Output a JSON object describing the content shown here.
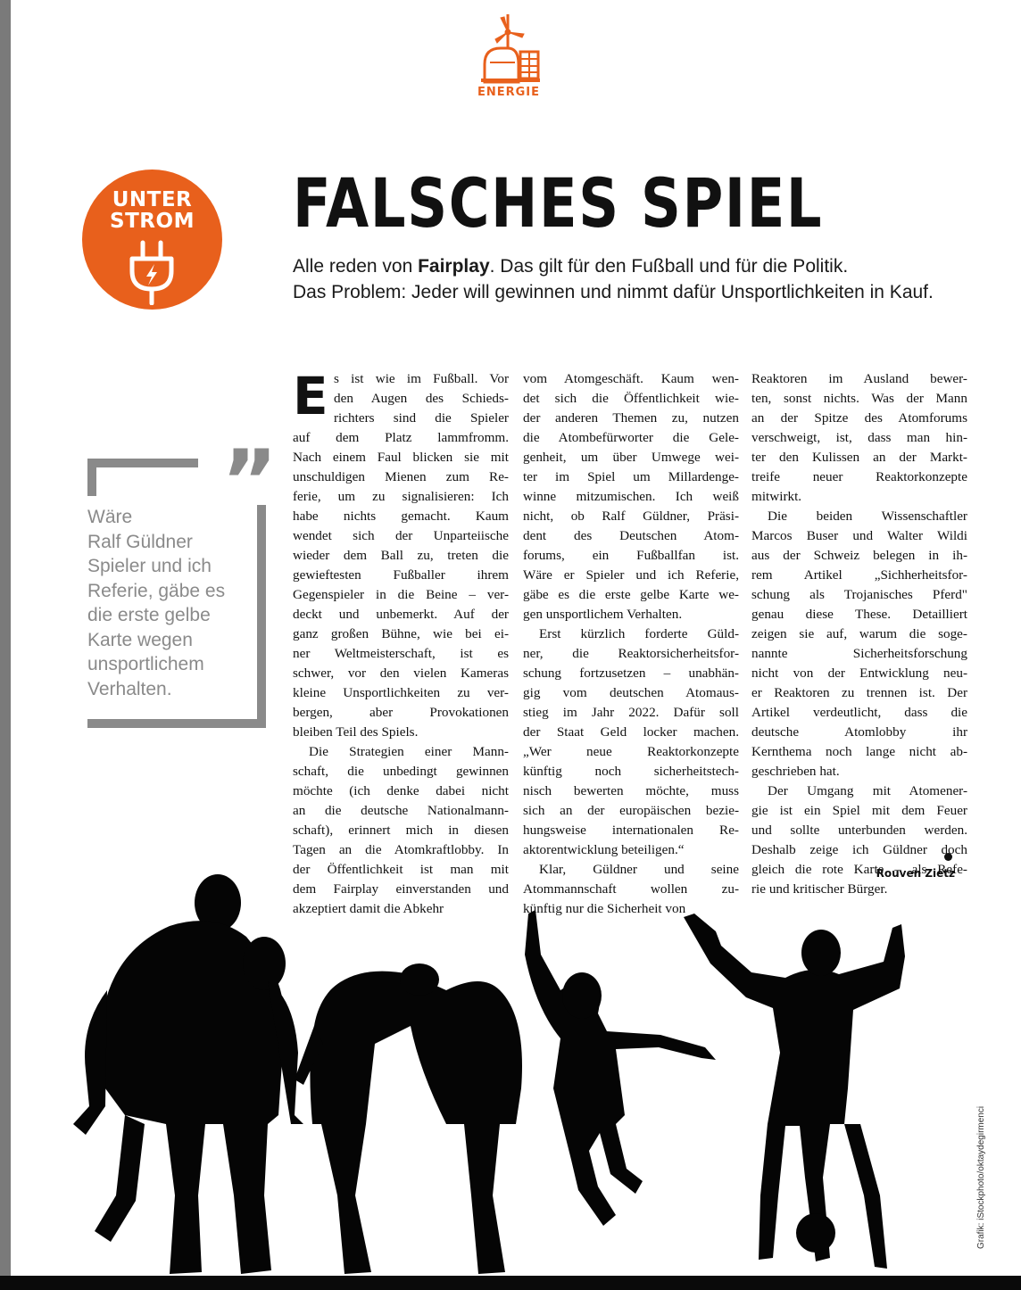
{
  "section": {
    "label": "ENERGIE",
    "icon": "power-plant-icon",
    "color": "#e8601c"
  },
  "badge": {
    "line1": "UNTER",
    "line2": "STROM",
    "icon": "plug-icon",
    "color": "#e8601c"
  },
  "headline": "FALSCHES SPIEL",
  "lead": {
    "line1_pre": "Alle reden von ",
    "line1_bold": "Fairplay",
    "line1_post": ". Das gilt für den Fußball und für die Politik.",
    "line2": "Das Problem: Jeder will gewinnen und nimmt dafür Unsportlichkeiten in Kauf."
  },
  "quote": {
    "marks": "”",
    "lines": [
      "Wäre",
      "Ralf Güldner",
      "Spieler und ich",
      "Referie, gäbe es",
      "die erste gelbe",
      "Karte wegen",
      "unsportlichem",
      "Verhalten."
    ]
  },
  "article": {
    "dropcap": "E",
    "col1": [
      "s ist wie im Fußball. Vor",
      "den Augen des Schieds-",
      "richters sind die Spieler",
      "auf dem Platz lammfromm.",
      "Nach einem Faul blicken sie mit",
      "unschuldigen Mienen zum Re-",
      "ferie, um zu signalisieren: Ich",
      "habe nichts gemacht. Kaum",
      "wendet sich der Unparteiische",
      "wieder dem Ball zu, treten die",
      "gewieftesten Fußballer ihrem",
      "Gegenspieler in die Beine – ver-",
      "deckt und unbemerkt. Auf der",
      "ganz großen Bühne, wie bei ei-",
      "ner Weltmeisterschaft, ist es",
      "schwer, vor den vielen Kameras",
      "kleine Unsportlichkeiten zu ver-",
      "bergen, aber Provokationen",
      "bleiben Teil des Spiels.",
      "Die Strategien einer Mann-",
      "schaft, die unbedingt gewinnen",
      "möchte (ich denke dabei nicht",
      "an die deutsche Nationalmann-",
      "schaft), erinnert mich in diesen",
      "Tagen an die Atomkraftlobby. In",
      "der Öffentlichkeit ist man mit",
      "dem Fairplay einverstanden und",
      "akzeptiert damit die Abkehr"
    ],
    "col2": [
      "vom Atomgeschäft. Kaum wen-",
      "det sich die Öffentlichkeit wie-",
      "der anderen Themen zu, nutzen",
      "die Atombefürworter die Gele-",
      "genheit, um über Umwege wei-",
      "ter im Spiel um Millardenge-",
      "winne mitzumischen. Ich weiß",
      "nicht, ob Ralf Güldner, Präsi-",
      "dent des Deutschen Atom-",
      "forums, ein Fußballfan ist.",
      "Wäre er Spieler und ich Referie,",
      "gäbe es die erste gelbe Karte we-",
      "gen unsportlichem Verhalten.",
      "Erst kürzlich forderte Güld-",
      "ner, die Reaktorsicherheitsfor-",
      "schung fortzusetzen – unabhän-",
      "gig vom deutschen Atomaus-",
      "stieg im Jahr 2022. Dafür soll",
      "der Staat Geld locker machen.",
      "„Wer neue Reaktorkonzepte",
      "künftig noch sicherheitstech-",
      "nisch bewerten möchte, muss",
      "sich an der europäischen bezie-",
      "hungsweise internationalen Re-",
      "aktorentwicklung beteiligen.“",
      "Klar, Güldner und seine",
      "Atommannschaft wollen zu-",
      "künftig nur die Sicherheit von"
    ],
    "col3": [
      "Reaktoren im Ausland bewer-",
      "ten, sonst nichts. Was der Mann",
      "an der Spitze des Atomforums",
      "verschweigt, ist, dass man hin-",
      "ter den Kulissen an der Markt-",
      "treife neuer Reaktorkonzepte",
      "mitwirkt.",
      "Die beiden Wissenschaftler",
      "Marcos Buser und Walter Wildi",
      "aus der Schweiz belegen in ih-",
      "rem Artikel „Sichherheitsfor-",
      "schung als Trojanisches Pferd\"",
      "genau diese These. Detailliert",
      "zeigen sie auf, warum die soge-",
      "nannte Sicherheitsforschung",
      "nicht von der Entwicklung neu-",
      "er Reaktoren zu trennen ist. Der",
      "Artikel verdeutlicht, dass die",
      "deutsche Atomlobby ihr",
      "Kernthema noch lange nicht ab-",
      "geschrieben hat.",
      "Der Umgang mit Atomener-",
      "gie ist ein Spiel mit dem Feuer",
      "und sollte unterbunden werden.",
      "Deshalb zeige ich Güldner doch",
      "gleich die rote Karte – als Refe-",
      "rie und kritischer Bürger."
    ],
    "author": "Rouven Zietz"
  },
  "credit": "Grafik: iStockphoto/oktaydegirmenci"
}
